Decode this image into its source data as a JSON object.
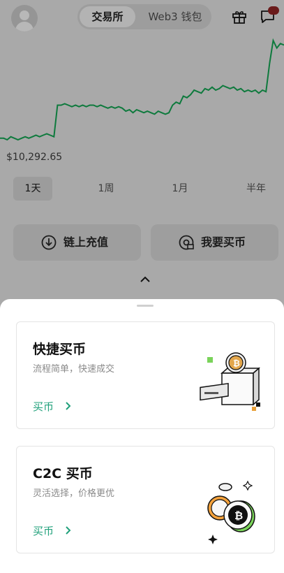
{
  "header": {
    "tabs": [
      {
        "label": "交易所",
        "active": true
      },
      {
        "label": "Web3 钱包",
        "active": false
      }
    ]
  },
  "chart_data": {
    "type": "line",
    "price_label": "$10,292.65",
    "line_color": "#0e7a3d",
    "values": [
      30,
      30,
      29,
      31,
      30,
      29,
      30,
      31,
      30,
      31,
      32,
      31,
      32,
      33,
      32,
      31,
      52,
      52,
      53,
      52,
      51,
      52,
      51,
      52,
      51,
      52,
      52,
      51,
      52,
      51,
      50,
      51,
      50,
      51,
      50,
      48,
      49,
      47,
      49,
      48,
      47,
      48,
      47,
      46,
      48,
      47,
      46,
      47,
      52,
      54,
      53,
      58,
      57,
      59,
      62,
      61,
      60,
      63,
      62,
      64,
      62,
      63,
      65,
      64,
      63,
      64,
      62,
      63,
      61,
      62,
      61,
      62,
      60,
      62,
      61,
      80,
      95,
      90,
      93,
      92
    ]
  },
  "periods": [
    {
      "label": "1天",
      "active": true
    },
    {
      "label": "1周",
      "active": false
    },
    {
      "label": "1月",
      "active": false
    },
    {
      "label": "半年",
      "active": false
    }
  ],
  "actions": {
    "deposit_label": "链上充值",
    "buy_label": "我要买币"
  },
  "sheet": {
    "cards": [
      {
        "title": "快捷买币",
        "subtitle": "流程简单，快速成交",
        "link": "买币"
      },
      {
        "title": "C2C 买币",
        "subtitle": "灵活选择，价格更优",
        "link": "买币"
      }
    ]
  },
  "colors": {
    "accent": "#1fa07a",
    "overlay": "#a9a9a9"
  }
}
